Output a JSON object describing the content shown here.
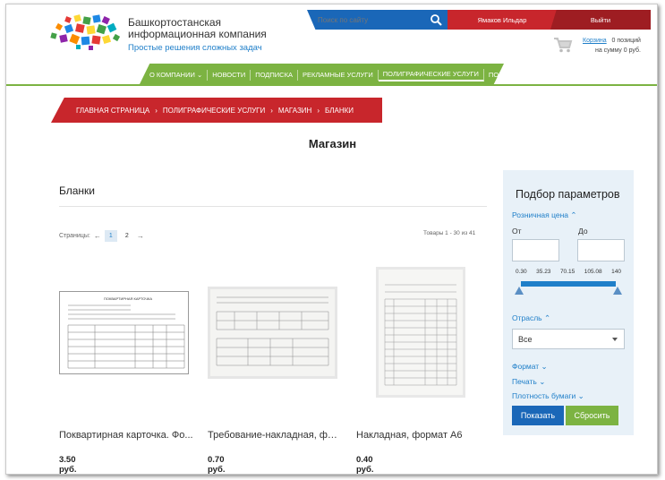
{
  "header": {
    "brand_line1": "Башкортостанская",
    "brand_line2": "информационная компания",
    "slogan": "Простые решения сложных задач",
    "search_placeholder": "Поиск по сайту",
    "user_name": "Ямаков Ильдар",
    "logout_label": "Выйти",
    "cart_link": "Корзина",
    "cart_count": "0 позиций",
    "cart_sum": "на сумму 0 руб."
  },
  "nav": {
    "items": [
      {
        "label": "О КОМПАНИИ ⌄"
      },
      {
        "label": "НОВОСТИ"
      },
      {
        "label": "ПОДПИСКА"
      },
      {
        "label": "РЕКЛАМНЫЕ УСЛУГИ"
      },
      {
        "label": "ПОЛИГРАФИЧЕСКИЕ УСЛУГИ"
      },
      {
        "label": "ПОМОЩЬ ⌄"
      }
    ]
  },
  "breadcrumbs": {
    "items": [
      {
        "label": "ГЛАВНАЯ СТРАНИЦА"
      },
      {
        "label": "ПОЛИГРАФИЧЕСКИЕ УСЛУГИ"
      },
      {
        "label": "МАГАЗИН"
      },
      {
        "label": "БЛАНКИ"
      }
    ],
    "separator": "›"
  },
  "page_title": "Магазин",
  "category_title": "Бланки",
  "pager": {
    "label": "Страницы:",
    "prev": "←",
    "pages": [
      "1",
      "2"
    ],
    "next": "→",
    "count_text": "Товары 1 - 30 из 41"
  },
  "products": [
    {
      "name": "Поквартирная карточка. Фо...",
      "price": "3.50 руб.",
      "doc_title": "ПОКВАРТИРНАЯ КАРТОЧКА"
    },
    {
      "name": "Требование-накладная, фор...",
      "price": "0.70 руб."
    },
    {
      "name": "Накладная, формат А6",
      "price": "0.40 руб."
    }
  ],
  "filter": {
    "title": "Подбор параметров",
    "retail_price": "Розничная цена ⌃",
    "from": "От",
    "to": "До",
    "ticks": [
      "0.30",
      "35.23",
      "70.15",
      "105.08",
      "140"
    ],
    "industry": "Отрасль ⌃",
    "industry_value": "Все",
    "format": "Формат ⌄",
    "print": "Печать ⌄",
    "density": "Плотность бумаги ⌄",
    "show_btn": "Показать",
    "reset_btn": "Сбросить"
  },
  "colors": {
    "brand_blue": "#1a67b8",
    "brand_red": "#c8262c",
    "brand_green": "#7cb342"
  }
}
